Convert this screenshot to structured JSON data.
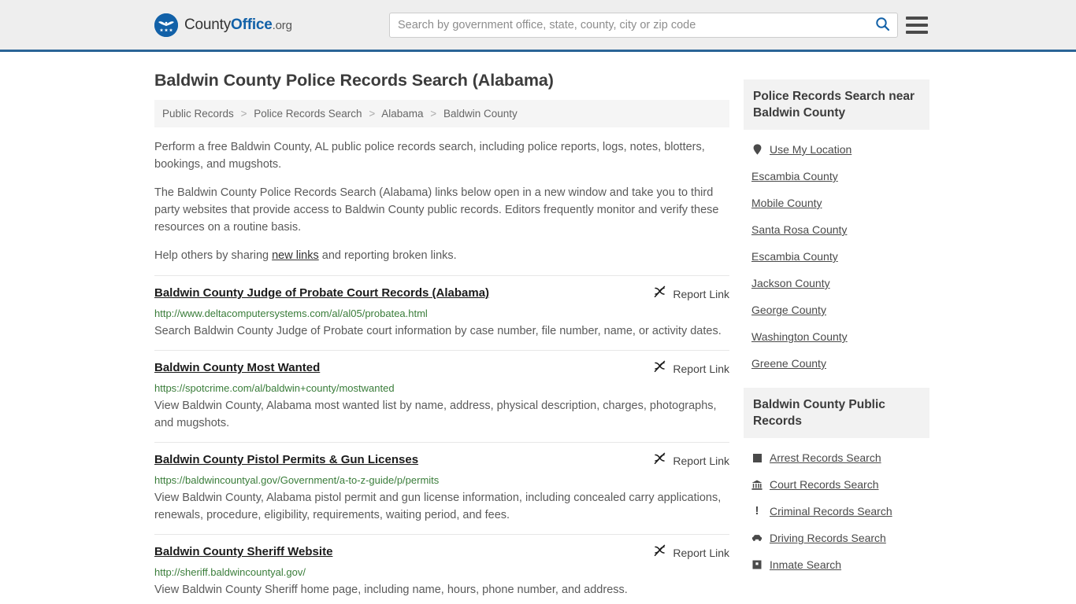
{
  "header": {
    "brand": {
      "part1": "County",
      "part2": "Office",
      "part3": ".org",
      "logo_icon": "eagle-seal-icon"
    },
    "search": {
      "placeholder": "Search by government office, state, county, city or zip code",
      "value": "",
      "icon": "search-icon"
    },
    "menu_icon": "hamburger-menu-icon"
  },
  "main": {
    "title": "Baldwin County Police Records Search (Alabama)",
    "breadcrumb": [
      "Public Records",
      "Police Records Search",
      "Alabama",
      "Baldwin County"
    ],
    "breadcrumb_separator": ">",
    "intro": {
      "p1": "Perform a free Baldwin County, AL public police records search, including police reports, logs, notes, blotters, bookings, and mugshots.",
      "p2": "The Baldwin County Police Records Search (Alabama) links below open in a new window and take you to third party websites that provide access to Baldwin County public records. Editors frequently monitor and verify these resources on a routine basis.",
      "p3_before": "Help others by sharing ",
      "p3_link": "new links",
      "p3_after": " and reporting broken links."
    },
    "report_link_label": "Report Link",
    "report_link_icon": "broken-link-icon",
    "results": [
      {
        "title": "Baldwin County Judge of Probate Court Records (Alabama)",
        "url": "http://www.deltacomputersystems.com/al/al05/probatea.html",
        "description": "Search Baldwin County Judge of Probate court information by case number, file number, name, or activity dates."
      },
      {
        "title": "Baldwin County Most Wanted",
        "url": "https://spotcrime.com/al/baldwin+county/mostwanted",
        "description": "View Baldwin County, Alabama most wanted list by name, address, physical description, charges, photographs, and mugshots."
      },
      {
        "title": "Baldwin County Pistol Permits & Gun Licenses",
        "url": "https://baldwincountyal.gov/Government/a-to-z-guide/p/permits",
        "description": "View Baldwin County, Alabama pistol permit and gun license information, including concealed carry applications, renewals, procedure, eligibility, requirements, waiting period, and fees."
      },
      {
        "title": "Baldwin County Sheriff Website",
        "url": "http://sheriff.baldwincountyal.gov/",
        "description": "View Baldwin County Sheriff home page, including name, hours, phone number, and address."
      }
    ]
  },
  "sidebar": {
    "nearby": {
      "title": "Police Records Search near Baldwin County",
      "items": [
        {
          "label": "Use My Location",
          "icon": "map-pin-icon"
        },
        {
          "label": "Escambia County",
          "icon": ""
        },
        {
          "label": "Mobile County",
          "icon": ""
        },
        {
          "label": "Santa Rosa County",
          "icon": ""
        },
        {
          "label": "Escambia County",
          "icon": ""
        },
        {
          "label": "Jackson County",
          "icon": ""
        },
        {
          "label": "George County",
          "icon": ""
        },
        {
          "label": "Washington County",
          "icon": ""
        },
        {
          "label": "Greene County",
          "icon": ""
        }
      ]
    },
    "public_records": {
      "title": "Baldwin County Public Records",
      "items": [
        {
          "label": "Arrest Records Search",
          "icon": "square-icon"
        },
        {
          "label": "Court Records Search",
          "icon": "courthouse-icon"
        },
        {
          "label": "Criminal Records Search",
          "icon": "exclamation-icon"
        },
        {
          "label": "Driving Records Search",
          "icon": "car-icon"
        },
        {
          "label": "Inmate Search",
          "icon": "building-icon"
        }
      ]
    }
  },
  "colors": {
    "accent_blue": "#1261a8",
    "header_border": "#2a6496",
    "header_bg": "#eeeeee",
    "url_green": "#3a7d3a",
    "panel_gray": "#f2f2f2"
  }
}
